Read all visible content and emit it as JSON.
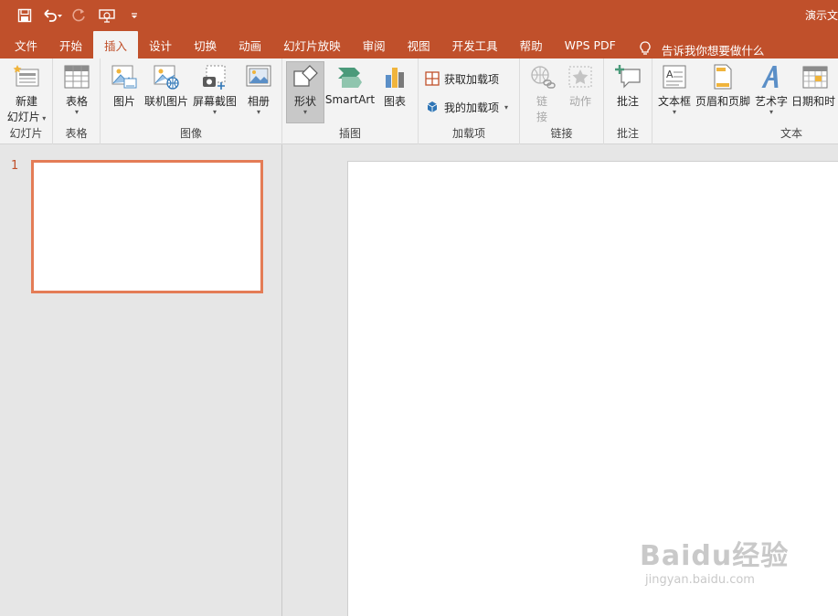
{
  "title_bar": {
    "title": "演示文",
    "quick_access": [
      {
        "icon": "save-icon"
      },
      {
        "icon": "undo-icon"
      },
      {
        "icon": "redo-icon"
      },
      {
        "icon": "present-from-start-icon"
      },
      {
        "icon": "customize-qat-icon"
      }
    ]
  },
  "tabs": [
    "文件",
    "开始",
    "插入",
    "设计",
    "切换",
    "动画",
    "幻灯片放映",
    "审阅",
    "视图",
    "开发工具",
    "帮助",
    "WPS PDF"
  ],
  "active_tab": "插入",
  "tell_me": "告诉我你想要做什么",
  "ribbon": {
    "slides": {
      "label": "幻灯片",
      "new_slide_line1": "新建",
      "new_slide_line2": "幻灯片"
    },
    "tables": {
      "label": "表格",
      "table": "表格"
    },
    "images": {
      "label": "图像",
      "picture": "图片",
      "online_picture": "联机图片",
      "screenshot": "屏幕截图",
      "album": "相册"
    },
    "illustrations": {
      "label": "插图",
      "shapes": "形状",
      "smartart": "SmartArt",
      "chart": "图表"
    },
    "addins": {
      "label": "加载项",
      "get_addins": "获取加载项",
      "my_addins": "我的加载项"
    },
    "links": {
      "label": "链接",
      "link_line1": "链",
      "link_line2": "接",
      "action": "动作"
    },
    "comments": {
      "label": "批注",
      "comment": "批注"
    },
    "text": {
      "label": "文本",
      "textbox": "文本框",
      "header_footer": "页眉和页脚",
      "wordart": "艺术字",
      "datetime": "日期和时"
    }
  },
  "slides_panel": {
    "slide_number": "1"
  },
  "colors": {
    "accent": "#c0502b",
    "thumb_border": "#e47c56"
  },
  "watermark": {
    "main": "Baidu经验",
    "sub": "jingyan.baidu.com"
  }
}
